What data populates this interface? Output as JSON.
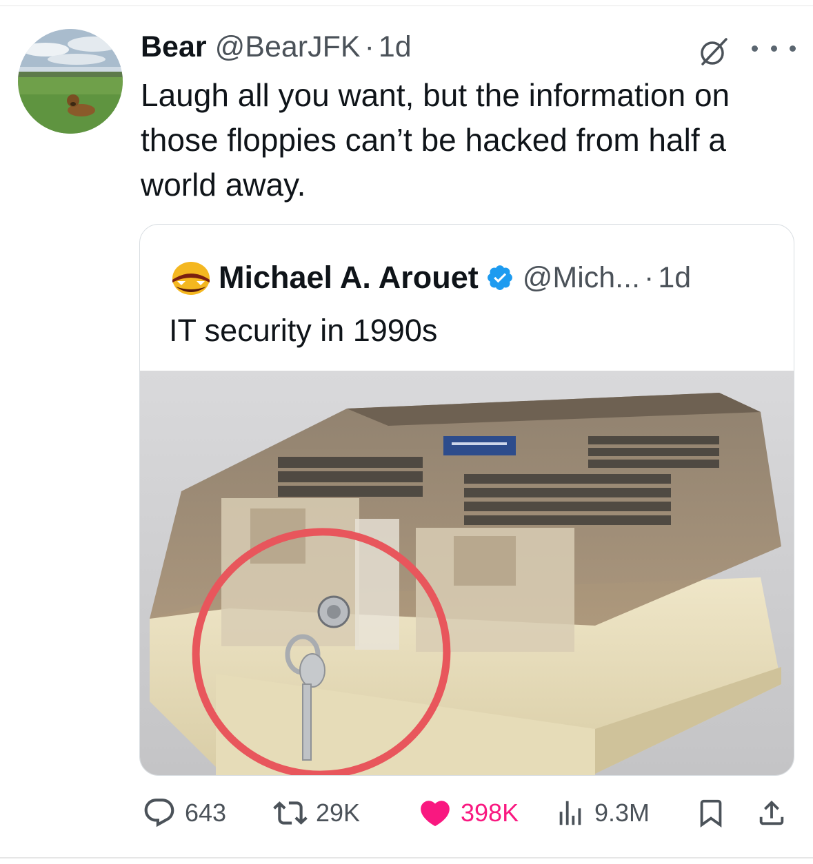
{
  "post": {
    "author_name": "Bear",
    "author_handle": "@BearJFK",
    "separator": "·",
    "time": "1d",
    "text": "Laugh all you want, but the information on those floppies can’t be hacked from half a world away."
  },
  "quote": {
    "author_name": "Michael A. Arouet",
    "author_handle": "@Mich...",
    "separator": "·",
    "time": "1d",
    "text": "IT security in 1990s",
    "verified": true
  },
  "actions": {
    "replies": "643",
    "reposts": "29K",
    "likes": "398K",
    "views": "9.3M"
  },
  "colors": {
    "like_active": "#f91880",
    "verified_blue": "#1d9bf0",
    "muted_text": "#4b5259",
    "annotation_circle": "#e8565c"
  },
  "icons": [
    "avatar-dog-in-field",
    "grok-icon",
    "more-icon",
    "verified-badge-icon",
    "reply-icon",
    "repost-icon",
    "like-heart-icon",
    "views-icon",
    "bookmark-icon",
    "share-icon"
  ]
}
